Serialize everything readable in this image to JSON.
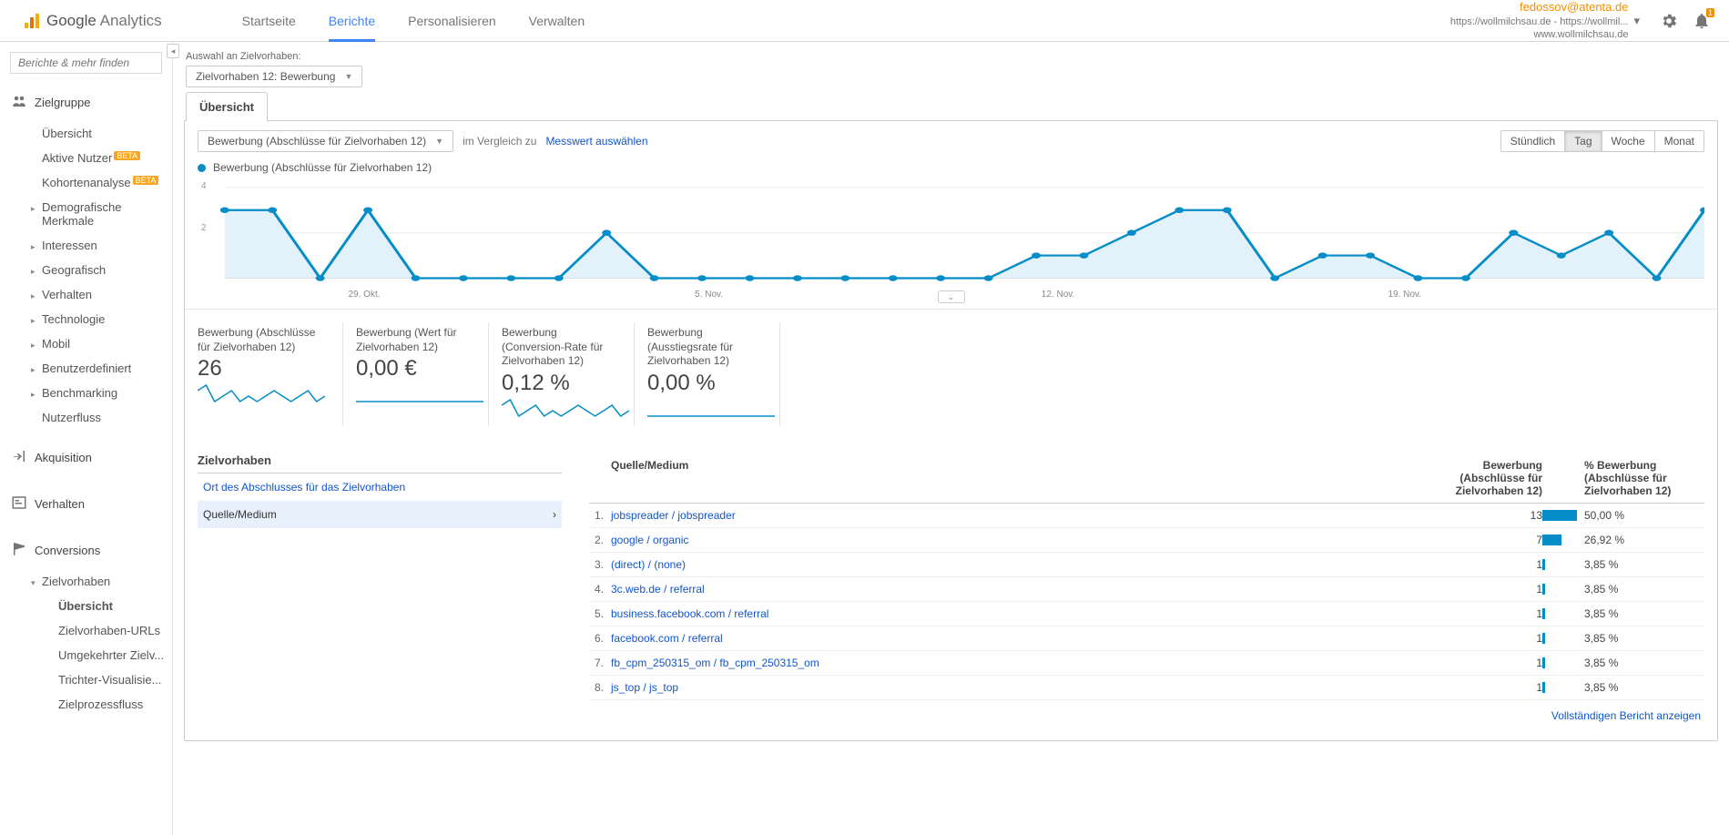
{
  "header": {
    "logo_text_bold": "Google",
    "logo_text_light": " Analytics",
    "tabs": [
      "Startseite",
      "Berichte",
      "Personalisieren",
      "Verwalten"
    ],
    "active_tab": 1,
    "account": {
      "email": "fedossov@atenta.de",
      "property": "https://wollmilchsau.de - https://wollmil...",
      "view": "www.wollmilchsau.de"
    },
    "bell_count": "1"
  },
  "sidebar": {
    "search_placeholder": "Berichte & mehr finden",
    "sections": {
      "zielgruppe": {
        "label": "Zielgruppe",
        "items": [
          {
            "label": "Übersicht"
          },
          {
            "label": "Aktive Nutzer",
            "badge": "BETA"
          },
          {
            "label": "Kohortenanalyse",
            "badge": "BETA"
          },
          {
            "label": "Demografische Merkmale",
            "exp": true
          },
          {
            "label": "Interessen",
            "exp": true
          },
          {
            "label": "Geografisch",
            "exp": true
          },
          {
            "label": "Verhalten",
            "exp": true
          },
          {
            "label": "Technologie",
            "exp": true
          },
          {
            "label": "Mobil",
            "exp": true
          },
          {
            "label": "Benutzerdefiniert",
            "exp": true
          },
          {
            "label": "Benchmarking",
            "exp": true
          },
          {
            "label": "Nutzerfluss"
          }
        ]
      },
      "akquisition": {
        "label": "Akquisition"
      },
      "verhalten": {
        "label": "Verhalten"
      },
      "conversions": {
        "label": "Conversions",
        "zielvorhaben_label": "Zielvorhaben",
        "items": [
          {
            "label": "Übersicht",
            "bold": true
          },
          {
            "label": "Zielvorhaben-URLs"
          },
          {
            "label": "Umgekehrter Zielv..."
          },
          {
            "label": "Trichter-Visualisie..."
          },
          {
            "label": "Zielprozessfluss"
          }
        ]
      }
    }
  },
  "goal_selector": {
    "label": "Auswahl an Zielvorhaben:",
    "value": "Zielvorhaben 12: Bewerbung"
  },
  "overview_tab": "Übersicht",
  "metric_selector": {
    "value": "Bewerbung (Abschlüsse für Zielvorhaben 12)",
    "compare_label": "im Vergleich zu",
    "choose_metric": "Messwert auswählen"
  },
  "granularity": {
    "items": [
      "Stündlich",
      "Tag",
      "Woche",
      "Monat"
    ],
    "active": 1
  },
  "chart_legend": "Bewerbung (Abschlüsse für Zielvorhaben 12)",
  "chart_data": {
    "type": "line",
    "ylim": [
      0,
      4
    ],
    "yticks": [
      2,
      4
    ],
    "xlabels": [
      "29. Okt.",
      "5. Nov.",
      "12. Nov.",
      "19. Nov."
    ],
    "values": [
      3,
      3,
      0,
      3,
      0,
      0,
      0,
      0,
      2,
      0,
      0,
      0,
      0,
      0,
      0,
      0,
      0,
      1,
      1,
      2,
      3,
      3,
      0,
      1,
      1,
      0,
      0,
      2,
      1,
      2,
      0,
      3
    ]
  },
  "metrics": [
    {
      "title": "Bewerbung (Abschlüsse für Zielvorhaben 12)",
      "value": "26",
      "spark": [
        2,
        3,
        0,
        1,
        2,
        0,
        1,
        0,
        1,
        2,
        1,
        0,
        1,
        2,
        0,
        1
      ]
    },
    {
      "title": "Bewerbung (Wert für Zielvorhaben 12)",
      "value": "0,00 €",
      "spark": [
        0,
        0,
        0,
        0,
        0,
        0,
        0,
        0,
        0,
        0
      ]
    },
    {
      "title": "Bewerbung (Conversion-Rate für Zielvorhaben 12)",
      "value": "0,12 %",
      "spark": [
        2,
        3,
        0,
        1,
        2,
        0,
        1,
        0,
        1,
        2,
        1,
        0,
        1,
        2,
        0,
        1
      ]
    },
    {
      "title": "Bewerbung (Ausstiegsrate für Zielvorhaben 12)",
      "value": "0,00 %",
      "spark": [
        0,
        0,
        0,
        0,
        0,
        0,
        0,
        0,
        0,
        0
      ]
    }
  ],
  "dimension_panel": {
    "heading": "Zielvorhaben",
    "items": [
      {
        "label": "Ort des Abschlusses für das Zielvorhaben",
        "link": true
      },
      {
        "label": "Quelle/Medium",
        "selected": true
      }
    ]
  },
  "table": {
    "col_source": "Quelle/Medium",
    "col_count": "Bewerbung (Abschlüsse für Zielvorhaben 12)",
    "col_pct": "% Bewerbung (Abschlüsse für Zielvorhaben 12)",
    "rows": [
      {
        "idx": "1.",
        "src": "jobspreader / jobspreader",
        "count": "13",
        "pct": "50,00 %",
        "bar": 100
      },
      {
        "idx": "2.",
        "src": "google / organic",
        "count": "7",
        "pct": "26,92 %",
        "bar": 54
      },
      {
        "idx": "3.",
        "src": "(direct) / (none)",
        "count": "1",
        "pct": "3,85 %",
        "bar": 8
      },
      {
        "idx": "4.",
        "src": "3c.web.de / referral",
        "count": "1",
        "pct": "3,85 %",
        "bar": 8
      },
      {
        "idx": "5.",
        "src": "business.facebook.com / referral",
        "count": "1",
        "pct": "3,85 %",
        "bar": 8
      },
      {
        "idx": "6.",
        "src": "facebook.com / referral",
        "count": "1",
        "pct": "3,85 %",
        "bar": 8
      },
      {
        "idx": "7.",
        "src": "fb_cpm_250315_om / fb_cpm_250315_om",
        "count": "1",
        "pct": "3,85 %",
        "bar": 8
      },
      {
        "idx": "8.",
        "src": "js_top / js_top",
        "count": "1",
        "pct": "3,85 %",
        "bar": 8
      }
    ],
    "full_report": "Vollständigen Bericht anzeigen"
  }
}
